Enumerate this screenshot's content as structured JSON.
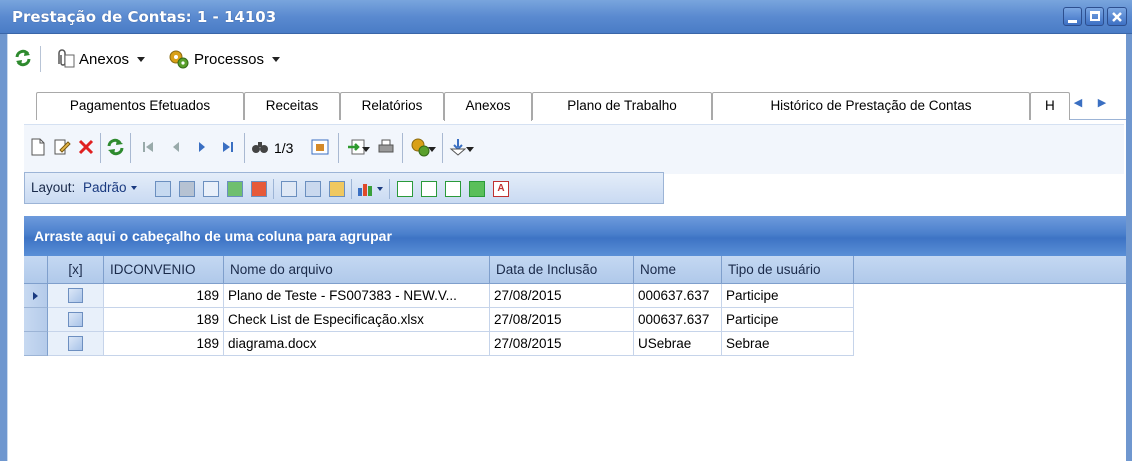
{
  "window": {
    "title": "Prestação de Contas: 1 - 14103"
  },
  "toolbar": {
    "anexos_label": "Anexos",
    "processos_label": "Processos"
  },
  "tabs": [
    "Pagamentos Efetuados",
    "Receitas",
    "Relatórios",
    "Anexos",
    "Plano de Trabalho",
    "Histórico de Prestação de Contas",
    "H"
  ],
  "active_tab": "Anexos",
  "grid_toolbar": {
    "record_counter": "1/3"
  },
  "layout_bar": {
    "label": "Layout:",
    "preset": "Padrão"
  },
  "group_hint": "Arraste aqui o cabeçalho de uma coluna para agrupar",
  "table": {
    "columns": [
      "[x]",
      "IDCONVENIO",
      "Nome do arquivo",
      "Data de Inclusão",
      "Nome",
      "Tipo de usuário"
    ],
    "rows": [
      {
        "id": "189",
        "arquivo": "Plano de Teste - FS007383 - NEW.V...",
        "data": "27/08/2015",
        "nome": "000637.637",
        "tipo": "Participe"
      },
      {
        "id": "189",
        "arquivo": "Check List de Especificação.xlsx",
        "data": "27/08/2015",
        "nome": "000637.637",
        "tipo": "Participe"
      },
      {
        "id": "189",
        "arquivo": "diagrama.docx",
        "data": "27/08/2015",
        "nome": "USebrae",
        "tipo": "Sebrae"
      }
    ]
  },
  "colors": {
    "titlebar": "#5a8ad0",
    "header": "#b0c9ea",
    "groupbar": "#4a7fcc",
    "delete_red": "#e02020",
    "refresh_green": "#2e9a2e"
  }
}
